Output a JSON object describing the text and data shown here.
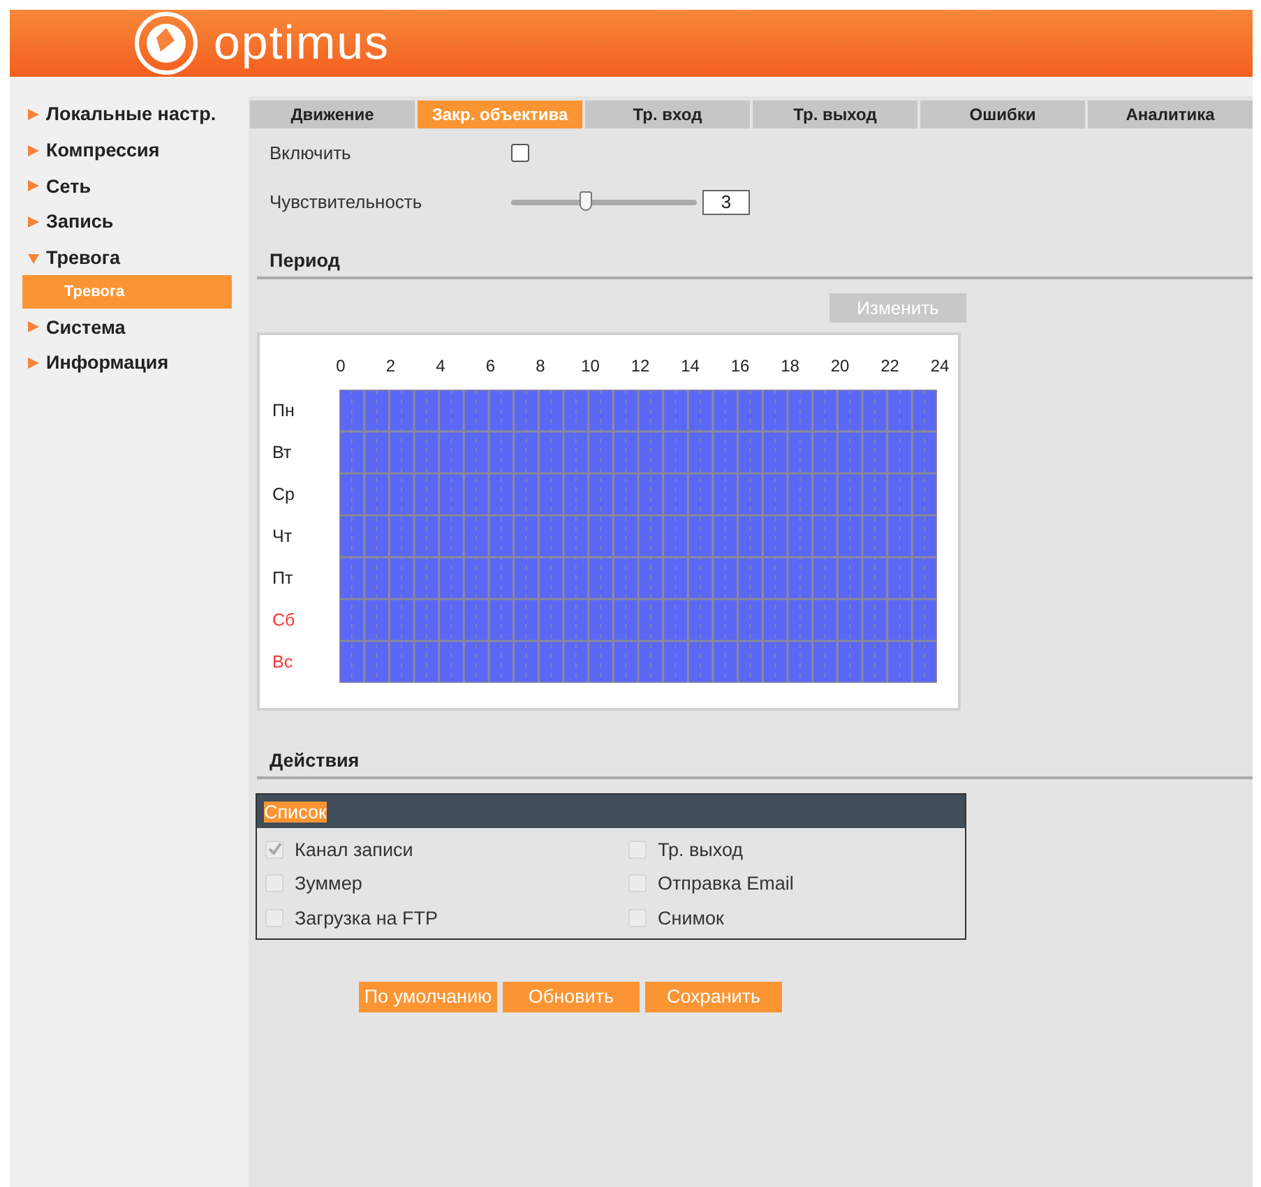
{
  "header": {
    "logo_text": "optimus"
  },
  "sidebar": {
    "items": [
      {
        "label": "Локальные настр.",
        "expanded": false
      },
      {
        "label": "Компрессия",
        "expanded": false
      },
      {
        "label": "Сеть",
        "expanded": false
      },
      {
        "label": "Запись",
        "expanded": false
      },
      {
        "label": "Тревога",
        "expanded": true,
        "children": [
          {
            "label": "Тревога",
            "selected": true
          }
        ]
      },
      {
        "label": "Система",
        "expanded": false
      },
      {
        "label": "Информация",
        "expanded": false
      }
    ]
  },
  "tabs": [
    {
      "label": "Движение",
      "selected": false
    },
    {
      "label": "Закр. объектива",
      "selected": true
    },
    {
      "label": "Тр. вход",
      "selected": false
    },
    {
      "label": "Тр. выход",
      "selected": false
    },
    {
      "label": "Ошибки",
      "selected": false
    },
    {
      "label": "Аналитика",
      "selected": false
    }
  ],
  "enable": {
    "label": "Включить",
    "checked": false
  },
  "sensitivity": {
    "label": "Чувствительность",
    "level": 0.4,
    "value": "3"
  },
  "period": {
    "heading": "Период",
    "edit_button": "Изменить",
    "hours": [
      "0",
      "2",
      "4",
      "6",
      "8",
      "10",
      "12",
      "14",
      "16",
      "18",
      "20",
      "22",
      "24"
    ],
    "days": [
      {
        "label": "Пн",
        "color": "#222222"
      },
      {
        "label": "Вт",
        "color": "#222222"
      },
      {
        "label": "Ср",
        "color": "#222222"
      },
      {
        "label": "Чт",
        "color": "#222222"
      },
      {
        "label": "Пт",
        "color": "#222222"
      },
      {
        "label": "Сб",
        "color": "#ff3333"
      },
      {
        "label": "Вс",
        "color": "#ff3333"
      }
    ]
  },
  "actions": {
    "heading": "Действия",
    "list_title": "Список",
    "items": [
      {
        "label": "Канал записи",
        "checked": true,
        "disabled": true
      },
      {
        "label": "Тр. выход",
        "checked": false,
        "disabled": true
      },
      {
        "label": "Зуммер",
        "checked": false,
        "disabled": true
      },
      {
        "label": "Отправка Email",
        "checked": false,
        "disabled": true
      },
      {
        "label": "Загрузка на FTP",
        "checked": false,
        "disabled": true
      },
      {
        "label": "Снимок",
        "checked": false,
        "disabled": true
      }
    ]
  },
  "buttons": [
    "По умолчанию",
    "Обновить",
    "Сохранить"
  ]
}
